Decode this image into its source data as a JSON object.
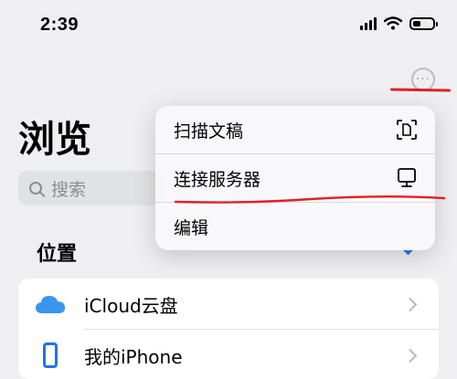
{
  "status_bar": {
    "time": "2:39"
  },
  "page": {
    "title": "浏览",
    "search_placeholder": "搜索",
    "section_title": "位置",
    "locations": [
      {
        "label": "iCloud云盘",
        "icon": "icloud-icon"
      },
      {
        "label": "我的iPhone",
        "icon": "iphone-icon"
      }
    ]
  },
  "menu": {
    "items": [
      {
        "label": "扫描文稿",
        "icon": "scan-document-icon"
      },
      {
        "label": "连接服务器",
        "icon": "monitor-icon"
      },
      {
        "label": "编辑"
      }
    ]
  },
  "colors": {
    "accent": "#1f73e8",
    "annotation": "#e0202a",
    "background": "#efeff2"
  }
}
